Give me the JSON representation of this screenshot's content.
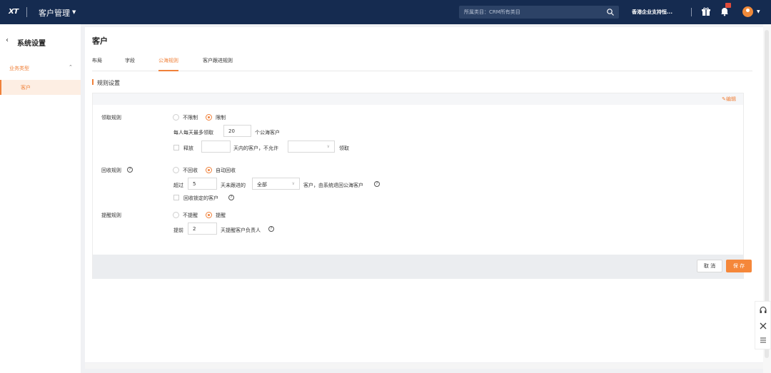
{
  "topbar": {
    "logo": "XT",
    "app_title": "客户管理",
    "search_placeholder": "所属类目：CRM所有类目",
    "org_name": "香港企业支持恒...",
    "colors": {
      "bg": "#152b50",
      "accent": "#f0813a"
    },
    "icons": [
      "search-icon",
      "gift-icon",
      "bell-icon",
      "avatar-icon"
    ]
  },
  "sidebar": {
    "back_icon": "chevron-left-icon",
    "title": "系统设置",
    "group_label": "业务类型",
    "items": [
      {
        "label": "客户",
        "active": true
      }
    ]
  },
  "main": {
    "page_title": "客户",
    "tabs": [
      {
        "label": "布局",
        "active": false
      },
      {
        "label": "字段",
        "active": false
      },
      {
        "label": "公海规则",
        "active": true
      },
      {
        "label": "客户跟进规则",
        "active": false
      }
    ],
    "section_title": "规则设置",
    "edit_label": "编辑",
    "claim": {
      "label": "领取规则",
      "opt_unlimited": "不限制",
      "opt_limited": "限制",
      "selected": "限制",
      "daily_prefix": "每人每天最多领取",
      "daily_value": "20",
      "daily_suffix": "个公海客户",
      "release_label": "释放",
      "release_days": "",
      "release_mid": "天内的客户，不允许",
      "release_select": "",
      "release_suffix": "领取"
    },
    "recycle": {
      "label": "回收规则",
      "opt_no": "不回收",
      "opt_auto": "自动回收",
      "selected": "自动回收",
      "exceed_prefix": "超过",
      "days_value": "5",
      "days_mid": "天未跟进的",
      "scope_value": "全部",
      "scope_suffix": "客户，由系统退回公海客户",
      "locked_label": "回收锁定的客户"
    },
    "remind": {
      "label": "提醒规则",
      "opt_no": "不提醒",
      "opt_yes": "提醒",
      "selected": "提醒",
      "ahead_prefix": "提前",
      "ahead_value": "2",
      "ahead_suffix": "天提醒客户负责人"
    },
    "footer": {
      "cancel_label": "取 消",
      "save_label": "保 存"
    }
  }
}
